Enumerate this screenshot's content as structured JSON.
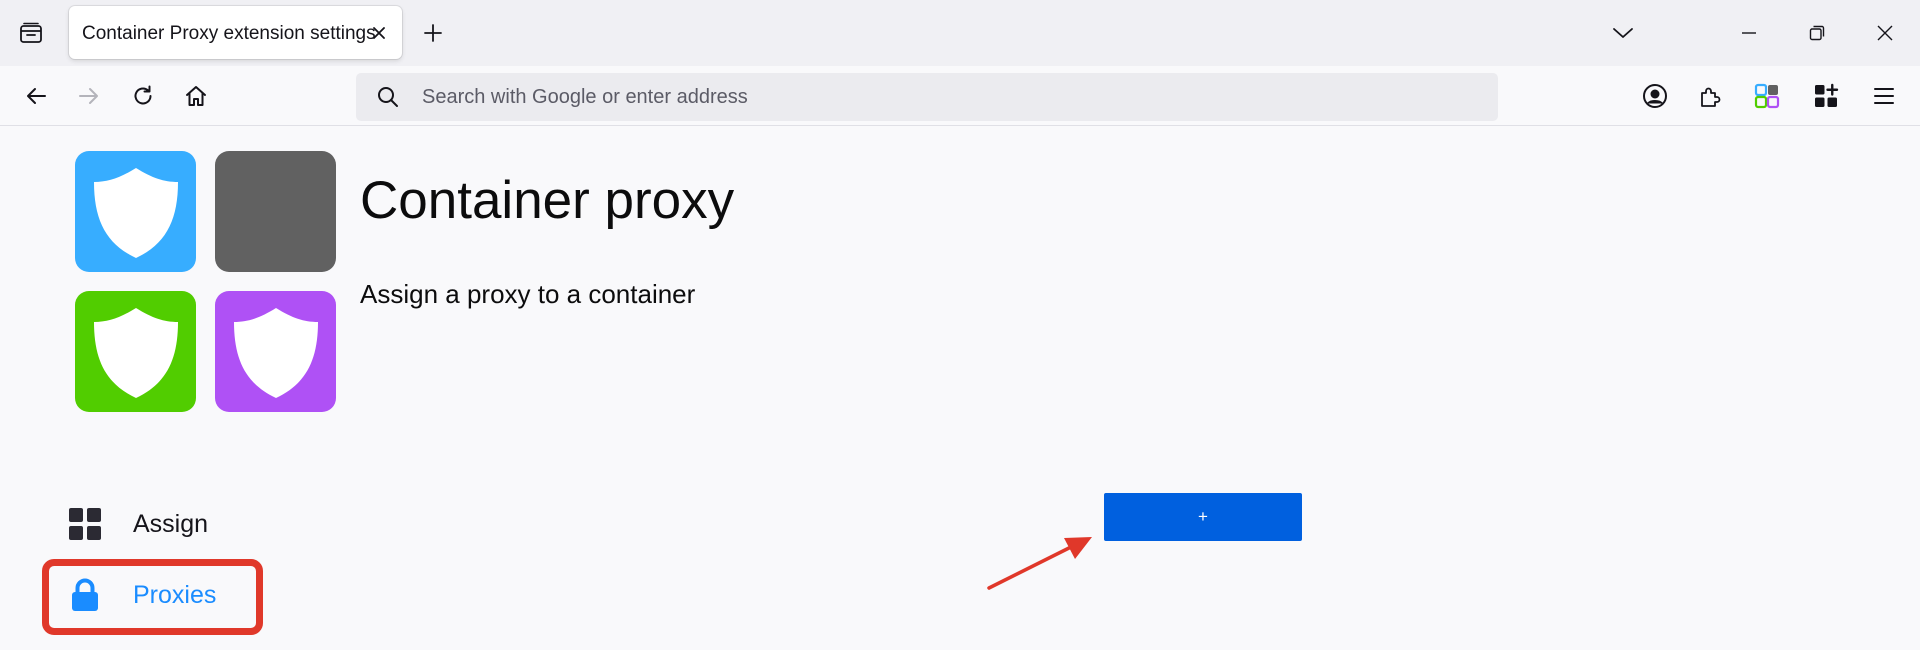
{
  "tab": {
    "title": "Container Proxy extension settings"
  },
  "urlbar": {
    "placeholder": "Search with Google or enter address",
    "value": ""
  },
  "page": {
    "title": "Container proxy",
    "subtitle": "Assign a proxy to a container",
    "logo_colors": [
      "#37adff",
      "#616161",
      "#51cd00",
      "#af51f5"
    ]
  },
  "sidebar": {
    "items": [
      {
        "label": "Assign",
        "icon": "grid-icon",
        "color": "#15141a"
      },
      {
        "label": "Proxies",
        "icon": "lock-icon",
        "color": "#1a8cff",
        "selected": true
      }
    ]
  },
  "main": {
    "add_button_label": "+"
  },
  "annotation": {
    "highlight_color": "#e0382a"
  }
}
